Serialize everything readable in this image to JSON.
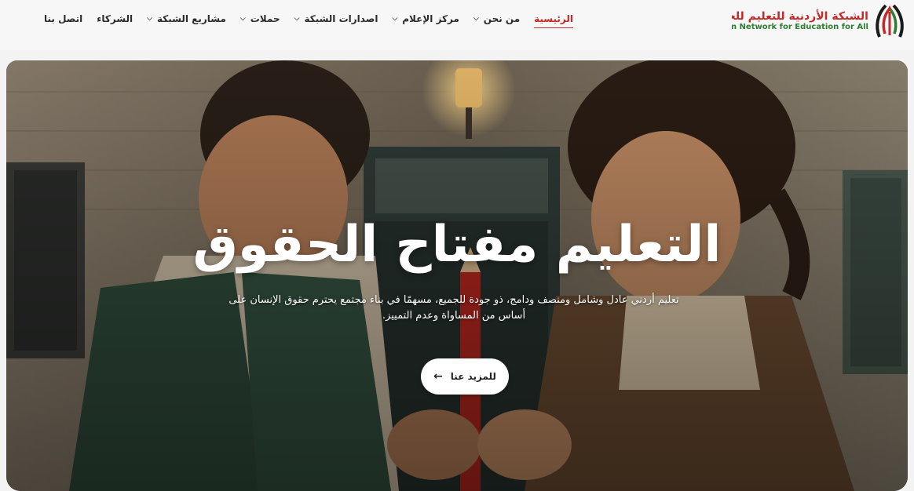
{
  "logo": {
    "arabic": "الشبكة الأردنية للتعليم للجميع",
    "english": "Jordan Network for Education for All"
  },
  "nav": {
    "items": [
      {
        "label": "الرئيسية",
        "active": true,
        "dropdown": false
      },
      {
        "label": "من نحن",
        "dropdown": true
      },
      {
        "label": "مركز الإعلام",
        "dropdown": true
      },
      {
        "label": "اصدارات الشبكة",
        "dropdown": true
      },
      {
        "label": "حملات",
        "dropdown": true
      },
      {
        "label": "مشاريع الشبكة",
        "dropdown": true
      },
      {
        "label": "الشركاء",
        "dropdown": false
      },
      {
        "label": "اتصل بنا",
        "dropdown": false
      }
    ]
  },
  "hero": {
    "title": "التعليم مفتاح الحقوق",
    "description": "تعليم أردني عادل وشامل ومنصف ودامج، ذو جودة للجميع، مسهمًا في بناء مجتمع يحترم حقوق الإنسان على أساس من المساواة وعدم التمييز.",
    "button_label": "للمزيد عنا",
    "button_icon": "arrow-left-icon"
  },
  "colors": {
    "accent_red": "#c62828",
    "accent_green": "#2e7d32"
  }
}
